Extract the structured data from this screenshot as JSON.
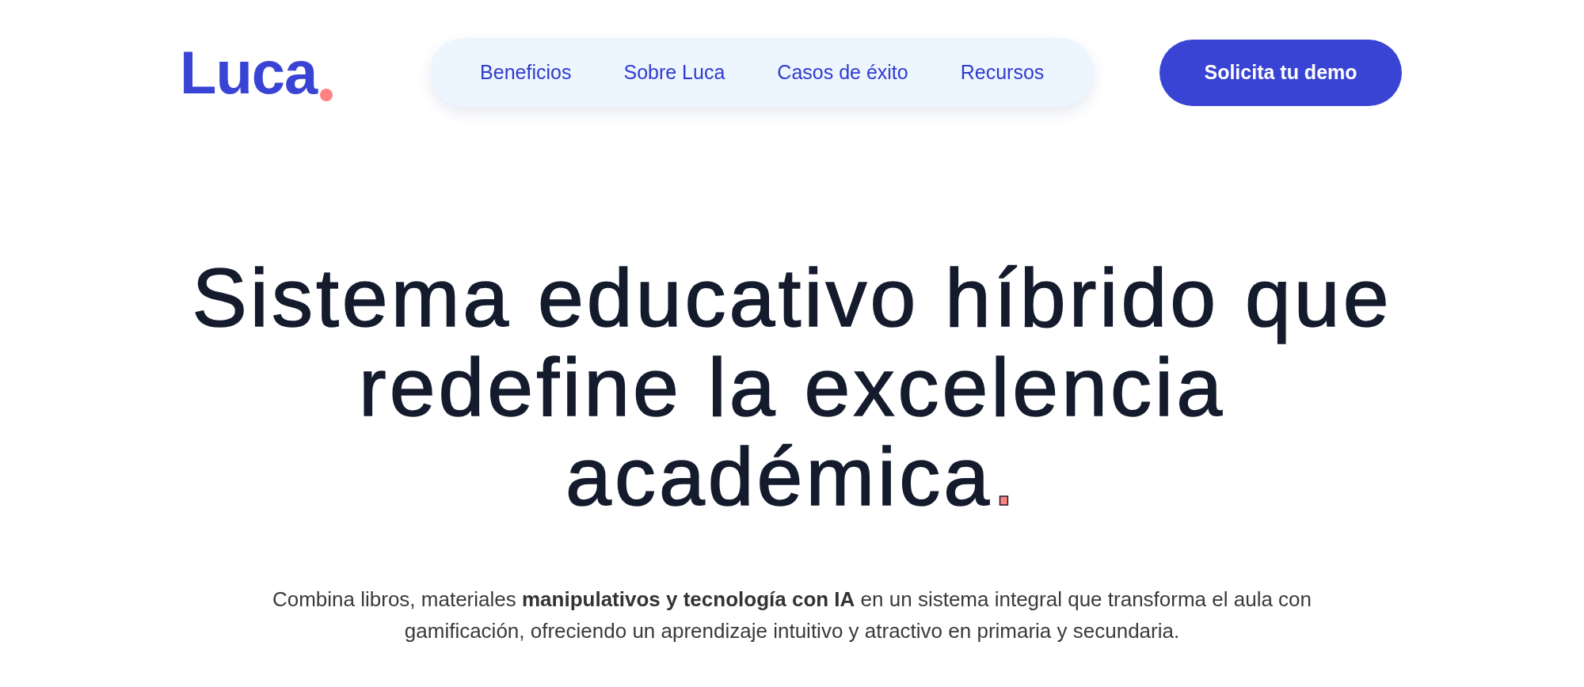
{
  "header": {
    "logo": "Luca",
    "nav": [
      {
        "label": "Beneficios"
      },
      {
        "label": "Sobre Luca"
      },
      {
        "label": "Casos de éxito"
      },
      {
        "label": "Recursos"
      }
    ],
    "cta": "Solicita tu demo"
  },
  "hero": {
    "title_lines": [
      "Sistema educativo híbrido que",
      "redefine la excelencia",
      "académica"
    ],
    "title_accent": ".",
    "description": "Combina libros, materiales **manipulativos y tecnología con IA** en un sistema integral que transforma el aula con gamificación, ofreciendo un aprendizaje intuitivo y atractivo en primaria y secundaria."
  }
}
